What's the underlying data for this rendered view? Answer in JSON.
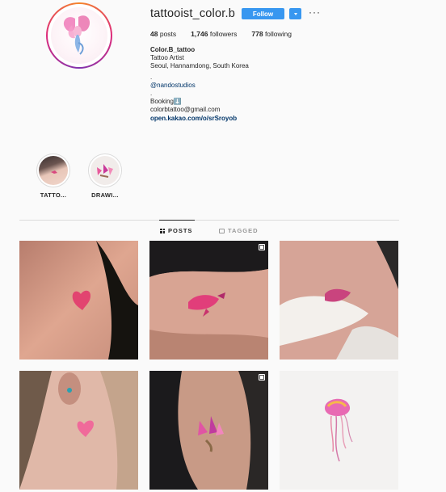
{
  "profile": {
    "username": "tattooist_color.b",
    "follow_label": "Follow",
    "more_label": "···",
    "stats": {
      "posts_count": "48",
      "posts_label": "posts",
      "followers_count": "1,746",
      "followers_label": "followers",
      "following_count": "778",
      "following_label": "following"
    },
    "bio": {
      "name": "Color.B_tattoo",
      "line1": "Tattoo Artist",
      "line2": "Seoul, Hannamdong, South Korea",
      "dot1": ".",
      "mention": "@nandostudios",
      "dot2": ".",
      "booking": "Booking⬇️",
      "email": "colorbtattoo@gmail.com",
      "link": "open.kakao.com/o/srSroyob"
    }
  },
  "highlights": [
    {
      "label": "TATTO..."
    },
    {
      "label": "DRAWI..."
    }
  ],
  "tabs": {
    "posts_label": "POSTS",
    "tagged_label": "TAGGED"
  },
  "colors": {
    "accent": "#3897f0",
    "link": "#003569",
    "divider": "#dbdbdb"
  },
  "icons": [
    "more-options-icon",
    "dropdown-arrow-icon",
    "grid-icon",
    "tag-icon",
    "multiple-posts-icon"
  ]
}
